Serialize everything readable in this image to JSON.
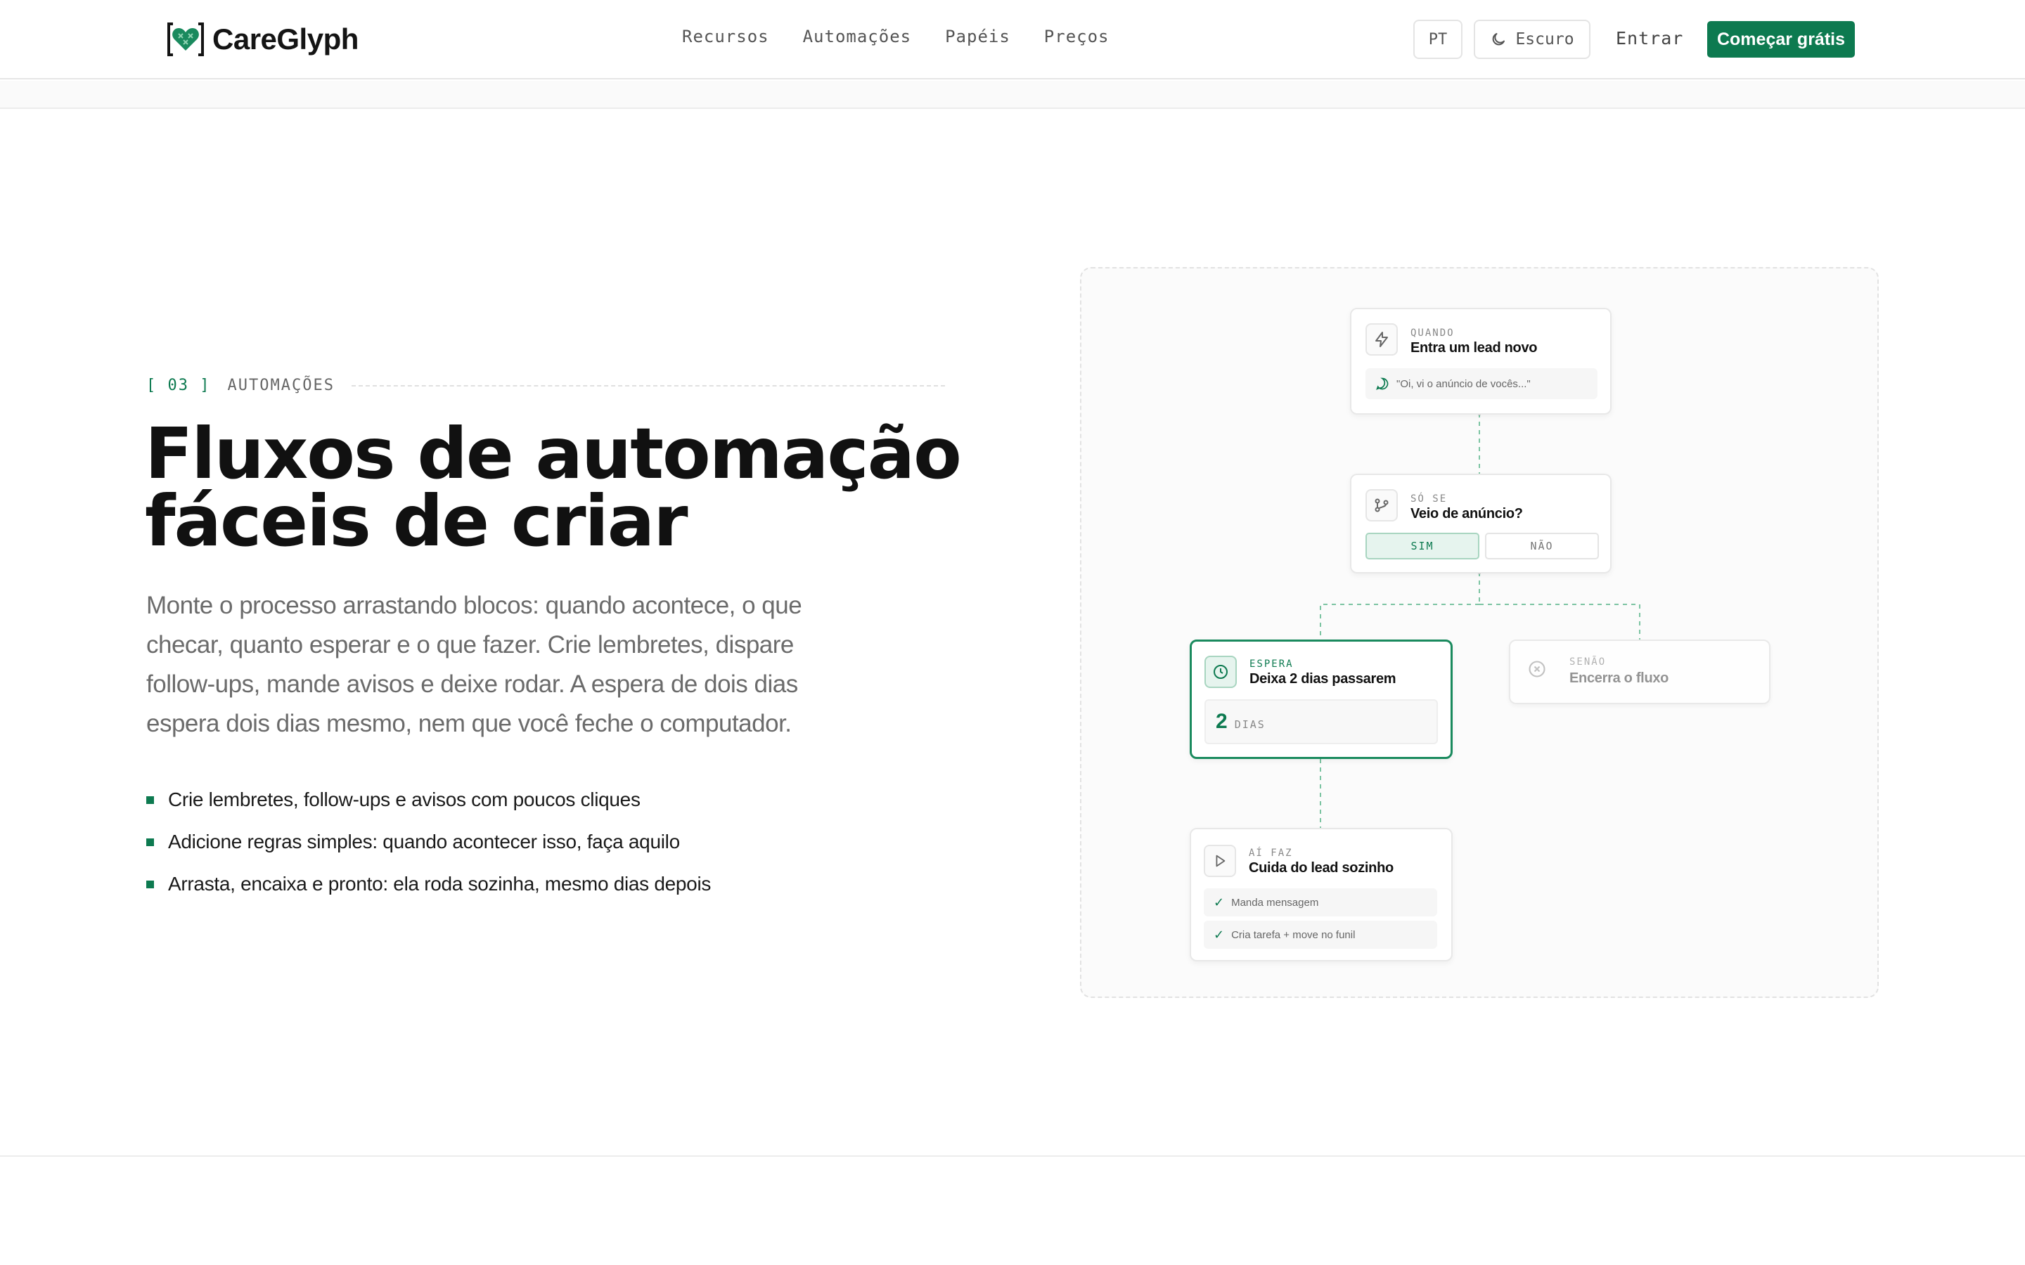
{
  "brand": {
    "name": "CareGlyph",
    "accent": "#0d7a50"
  },
  "nav": [
    {
      "label": "Recursos"
    },
    {
      "label": "Automações"
    },
    {
      "label": "Papéis"
    },
    {
      "label": "Preços"
    }
  ],
  "header": {
    "lang": "PT",
    "theme_label": "Escuro",
    "login_label": "Entrar",
    "cta_label": "Começar grátis"
  },
  "section": {
    "eyebrow_num": "[ 03 ]",
    "eyebrow_label": "AUTOMAÇÕES",
    "title_line1": "Fluxos de automação",
    "title_line2": "fáceis de criar",
    "lead": "Monte o processo arrastando blocos: quando acontece, o que checar, quanto esperar e o que fazer. Crie lembretes, dispare follow-ups, mande avisos e deixe rodar. A espera de dois dias espera dois dias mesmo, nem que você feche o computador.",
    "bullets": [
      "Crie lembretes, follow-ups e avisos com poucos cliques",
      "Adicione regras simples: quando acontecer isso, faça aquilo",
      "Arrasta, encaixa e pronto: ela roda sozinha, mesmo dias depois"
    ]
  },
  "flow": {
    "trigger": {
      "tag": "QUANDO",
      "title": "Entra um lead novo",
      "message": "\"Oi, vi o anúncio de vocês...\""
    },
    "condition": {
      "tag": "SÓ SE",
      "title": "Veio de anúncio?",
      "yes": "SIM",
      "no": "NÃO"
    },
    "wait": {
      "tag": "ESPERA",
      "title": "Deixa 2 dias passarem",
      "value": "2",
      "unit": "DIAS"
    },
    "else": {
      "tag": "SENÃO",
      "title": "Encerra o fluxo"
    },
    "action": {
      "tag": "AÍ FAZ",
      "title": "Cuida do lead sozinho",
      "steps": [
        "Manda mensagem",
        "Cria tarefa + move no funil"
      ]
    }
  }
}
